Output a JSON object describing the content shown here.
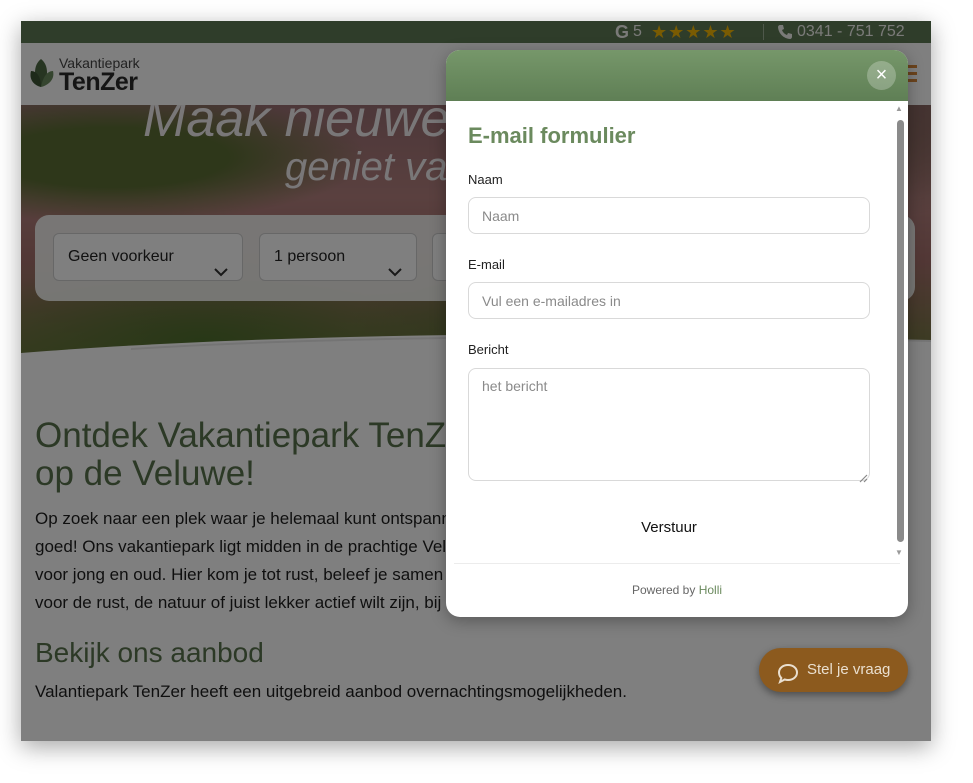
{
  "topbar": {
    "google_letter": "G",
    "rating": "5",
    "stars": "★★★★★",
    "phone": "0341 - 751 752"
  },
  "logo": {
    "small": "Vakantiepark",
    "big": "TenZer"
  },
  "hero": {
    "title": "Maak nieuwe",
    "subtitle": "geniet va",
    "select_type": "Geen voorkeur",
    "select_persons": "1 persoon"
  },
  "content": {
    "heading_line1": "Ontdek Vakantiepark TenZ",
    "heading_line2": "op de Veluwe!",
    "para_lines": [
      "Op zoek naar een plek waar je helemaal kunt ontspanne",
      "goed! Ons vakantiepark ligt midden in de prachtige Velu",
      "voor jong en oud. Hier kom je tot rust, beleef je samen d",
      "voor de rust, de natuur of juist lekker actief wilt zijn, bij o"
    ],
    "offer_heading": "Bekijk ons aanbod",
    "offer_text": "Valantiepark TenZer heeft een uitgebreid aanbod overnachtingsmogelijkheden."
  },
  "chat": {
    "label": "Stel je vraag"
  },
  "modal": {
    "close": "×",
    "title": "E-mail formulier",
    "name_label": "Naam",
    "name_placeholder": "Naam",
    "email_label": "E-mail",
    "email_placeholder": "Vul een e-mailadres in",
    "message_label": "Bericht",
    "message_placeholder": "het bericht",
    "submit": "Verstuur",
    "powered_by": "Powered by",
    "powered_brand": "Holli"
  },
  "colors": {
    "brand_green": "#5f7a55",
    "heading_green": "#59734c",
    "chat_orange": "#d9883a",
    "star_gold": "#f2b705"
  },
  "icons": [
    "phone-icon",
    "leaf-logo-icon",
    "chevron-down-icon",
    "menu-icon",
    "chat-bubble-icon",
    "close-icon",
    "resize-grip-icon"
  ]
}
